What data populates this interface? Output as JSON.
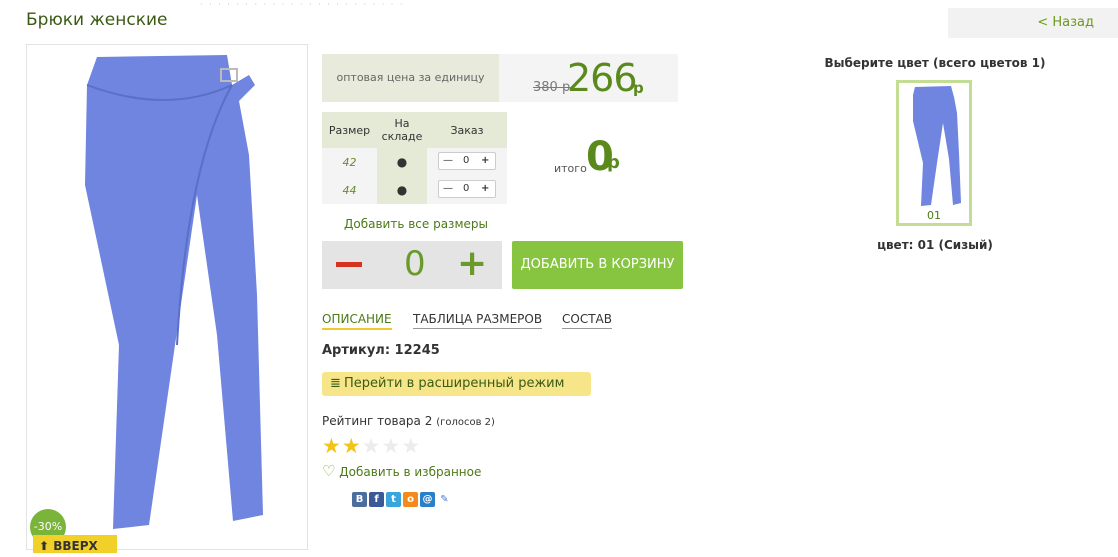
{
  "page": {
    "title": "Брюки женские",
    "back_label": "< Назад"
  },
  "product": {
    "discount_badge": "-30%",
    "scroll_top_label": "ВВЕРХ",
    "price_label": "оптовая цена за единицу",
    "old_price": "380 р",
    "price": "266",
    "currency": "р",
    "sizes_table": {
      "headers": [
        "Размер",
        "На складе",
        "Заказ"
      ],
      "rows": [
        {
          "size": "42",
          "stock": "●",
          "qty": "0"
        },
        {
          "size": "44",
          "stock": "●",
          "qty": "0"
        }
      ]
    },
    "total_label": "итого",
    "total_value": "0",
    "total_currency": "р",
    "add_all_label": "Добавить все размеры",
    "quantity": "0",
    "add_to_cart_label": "ДОБАВИТЬ В КОРЗИНУ",
    "tabs": [
      "ОПИСАНИЕ",
      "ТАБЛИЦА РАЗМЕРОВ",
      "СОСТАВ"
    ],
    "article": "Артикул: 12245",
    "extended_mode_label": "Перейти в расширенный режим",
    "rating_label": "Рейтинг товара 2",
    "rating_votes": "(голосов 2)",
    "rating_value": 2,
    "rating_max": 5,
    "favorite_label": "Добавить в избранное"
  },
  "colors": {
    "header": "Выберите цвет (всего цветов 1)",
    "items": [
      {
        "code": "01"
      }
    ],
    "current": "цвет: 01 (Сизый)"
  },
  "theme": {
    "accent": "#87c540",
    "garment": "#6f85e0"
  }
}
